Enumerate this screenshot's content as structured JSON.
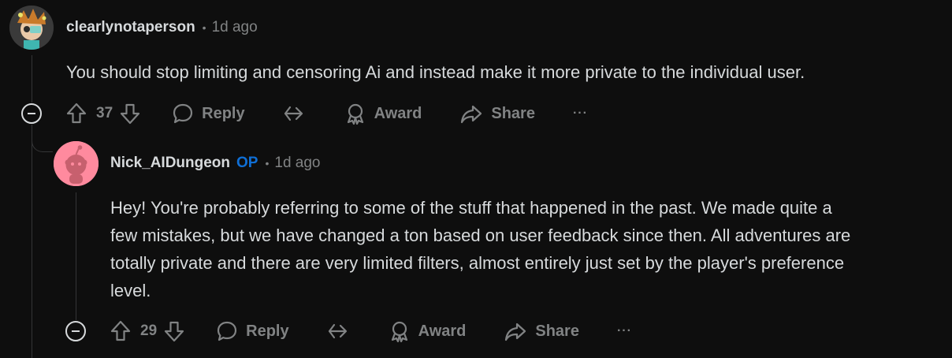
{
  "comments": [
    {
      "username": "clearlynotaperson",
      "separator": "•",
      "time": "1d ago",
      "body_lines": [
        "You should stop limiting and censoring Ai and instead make it more private to the individual user."
      ],
      "score": "37",
      "reply_label": "Reply",
      "award_label": "Award",
      "share_label": "Share",
      "more_label": "···"
    },
    {
      "username": "Nick_AIDungeon",
      "op_label": "OP",
      "separator": "•",
      "time": "1d ago",
      "body_lines": [
        "Hey! You're probably referring to some of the stuff that happened in the past. We made quite a",
        "few mistakes, but we have changed a ton based on user feedback since then. All adventures are",
        "totally private and there are very limited filters, almost entirely just set by the player's preference",
        "level."
      ],
      "score": "29",
      "reply_label": "Reply",
      "award_label": "Award",
      "share_label": "Share",
      "more_label": "···"
    }
  ],
  "colors": {
    "background": "#0e0e0e",
    "text": "#d7dadc",
    "muted": "#818384",
    "op_blue": "#0f6fd6",
    "thread_line": "#343536",
    "snoo_avatar_bg": "#ff8a9e"
  },
  "icons": {
    "upvote": "arrow-up-icon",
    "downvote": "arrow-down-icon",
    "reply": "speech-bubble-icon",
    "crosspost": "crosspost-arrow-icon",
    "award": "award-ribbon-icon",
    "share": "share-arrow-icon",
    "more": "ellipsis-icon",
    "collapse": "collapse-minus-icon"
  }
}
